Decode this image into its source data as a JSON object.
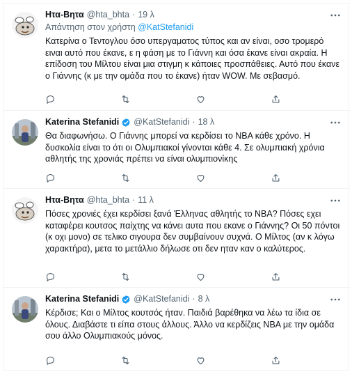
{
  "tweets": [
    {
      "name": "Ητα-Βητα",
      "handle": "@hta_bhta",
      "separator": "·",
      "time": "19 λ",
      "verified": false,
      "replying_prefix": "Απάντηση στον χρήστη",
      "replying_mention": "@KatStefanidi",
      "text": "Κατερίνα ο Τεντογλου όσο υπεργαματος τύπος και αν είναι, οσο τρομερό ειναι αυτό που έκανε, ε η φάση με το Γιάννη και όσα έκανε είναι ακραία. Η επίδοση του Μίλτου είναι μια στιγμη κ κάποιες προσπάθειες. Αυτό που έκανε ο Γιάννης (κ με την ομάδα που το έκανε) ήταν WOW. Με σεβασμό."
    },
    {
      "name": "Katerina Stefanidi",
      "handle": "@KatStefanidi",
      "separator": "·",
      "time": "18 λ",
      "verified": true,
      "text": "Θα διαφωνήσω. Ο Γιάννης μπορεί να κερδίσει το NBA κάθε χρόνο. Η δυσκολία είναι το ότι οι Ολυμπιακοί γίνονται κάθε 4. Σε ολυμπιακή χρόνια αθλητής της χρονιάς πρέπει να είναι ολυμπιονίκης"
    },
    {
      "name": "Ητα-Βητα",
      "handle": "@hta_bhta",
      "separator": "·",
      "time": "11 λ",
      "verified": false,
      "text": "Πόσες χρονιές έχει κερδίσει ξανά Έλληνας αθλητής το NBA? Πόσες εχει καταφέρει κουτσος παίχτης να κάνει αυτα που εκανε ο Γιάννης? Οι 50 πόντοι (κ οχι μονο) σε τελικο σιγουρα δεν συμβαίνουν συχνά. Ο Μίλτος (αν κ λόγω χαρακτήρα), μετα το μετάλλιο δήλωσε οτι δεν ηταν καν ο καλύτερος."
    },
    {
      "name": "Katerina Stefanidi",
      "handle": "@KatStefanidi",
      "separator": "·",
      "time": "8 λ",
      "verified": true,
      "text": "Κέρδισε; Και ο Μίλτος κουτσός ήταν. Παιδιά βαρέθηκα να λέω τα ίδια σε όλους. Διαβάστε τι είπα στους άλλους. Άλλο να κερδίζεις NBA με την ομάδα σου άλλο Ολυμπιακούς μόνος."
    }
  ],
  "icons": {
    "reply": "reply-icon",
    "retweet": "retweet-icon",
    "like": "heart-icon",
    "share": "share-icon",
    "more": "more-icon",
    "verified": "verified-badge-icon"
  },
  "colors": {
    "link": "#1d9bf0",
    "secondary_text": "#536471",
    "border": "#eff3f4"
  }
}
